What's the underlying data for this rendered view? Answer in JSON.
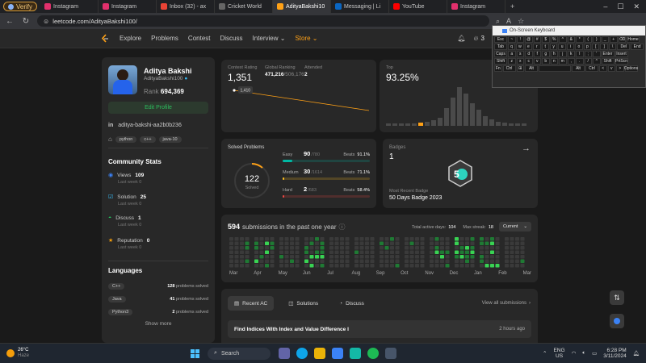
{
  "browser": {
    "verify_label": "Verify",
    "tabs": [
      {
        "label": "Instagram",
        "color": "#e1306c"
      },
      {
        "label": "Instagram",
        "color": "#e1306c"
      },
      {
        "label": "Inbox (32) - ax",
        "color": "#ea4335"
      },
      {
        "label": "Cricket World",
        "color": "#666666"
      },
      {
        "label": "AdityaBakshi10",
        "color": "#ffa116"
      },
      {
        "label": "Messaging | Li",
        "color": "#0a66c2"
      },
      {
        "label": "YouTube",
        "color": "#ff0000"
      },
      {
        "label": "Instagram",
        "color": "#e1306c"
      }
    ],
    "url": "leetcode.com/AdityaBakshi100/"
  },
  "nav": {
    "links": [
      "Explore",
      "Problems",
      "Contest",
      "Discuss",
      "Interview ⌄",
      "Store ⌄"
    ],
    "streak": "3"
  },
  "profile": {
    "name": "Aditya Bakshi",
    "username": "AdityaBakshi100",
    "rank_label": "Rank",
    "rank_value": "694,369",
    "edit_button": "Edit Profile",
    "linkedin": "aditya-bakshi-aa2b0b236",
    "tags": [
      "python",
      "c++",
      "java-10"
    ],
    "community_title": "Community Stats",
    "community": [
      {
        "label": "Views",
        "value": "109",
        "sub": "Last week 0",
        "color": "#3b82f6"
      },
      {
        "label": "Solution",
        "value": "25",
        "sub": "Last week 0",
        "color": "#38bdf8"
      },
      {
        "label": "Discuss",
        "value": "1",
        "sub": "Last week 0",
        "color": "#22c55e"
      },
      {
        "label": "Reputation",
        "value": "0",
        "sub": "Last week 0",
        "color": "#f59e0b"
      }
    ],
    "languages_title": "Languages",
    "languages": [
      {
        "name": "C++",
        "count": "128",
        "suffix": "problems solved"
      },
      {
        "name": "Java",
        "count": "41",
        "suffix": "problems solved"
      },
      {
        "name": "Python3",
        "count": "2",
        "suffix": "problems solved"
      }
    ],
    "show_more": "Show more"
  },
  "contest": {
    "rating_label": "Contest Rating",
    "rating_value": "1,351",
    "global_label": "Global Ranking",
    "global_value": "471,216",
    "global_total": "/506,176",
    "attended_label": "Attended",
    "attended_value": "2",
    "point_label": "1,410",
    "top_label": "Top",
    "top_value": "93.25%"
  },
  "solved": {
    "title": "Solved Problems",
    "total": "122",
    "total_label": "Solved",
    "rows": [
      {
        "level": "Easy",
        "count": "90",
        "total": "/780",
        "beats": "Beats",
        "pct": "91.1%",
        "color": "#00b8a3",
        "fill": 0.115
      },
      {
        "level": "Medium",
        "count": "30",
        "total": "/1614",
        "beats": "Beats",
        "pct": "71.1%",
        "color": "#ffc01e",
        "fill": 0.019
      },
      {
        "level": "Hard",
        "count": "2",
        "total": "/683",
        "beats": "Beats",
        "pct": "58.4%",
        "color": "#ef4743",
        "fill": 0.003
      }
    ]
  },
  "badges": {
    "title": "Badges",
    "count": "1",
    "recent_label": "Most Recent Badge",
    "recent_name": "50 Days Badge 2023"
  },
  "submissions": {
    "count": "594",
    "label": "submissions in the past one year",
    "active_label": "Total active days:",
    "active_value": "104",
    "streak_label": "Max streak:",
    "streak_value": "18",
    "dropdown": "Current",
    "months": [
      "Mar",
      "Apr",
      "May",
      "Jun",
      "Jul",
      "Aug",
      "Sep",
      "Oct",
      "Nov",
      "Dec",
      "Jan",
      "Feb",
      "Mar"
    ]
  },
  "recent": {
    "tabs": [
      "Recent AC",
      "Solutions",
      "Discuss"
    ],
    "view_all": "View all submissions",
    "item_title": "Find Indices With Index and Value Difference I",
    "item_time": "2 hours ago"
  },
  "osk": {
    "title": "On-Screen Keyboard",
    "rows": [
      [
        "Esc",
        "~",
        "!",
        "@",
        "#",
        "$",
        "%",
        "^",
        "&",
        "*",
        "(",
        ")",
        "_",
        "+",
        "⌫",
        "Home"
      ],
      [
        "Tab",
        "q",
        "w",
        "e",
        "r",
        "t",
        "y",
        "u",
        "i",
        "o",
        "p",
        "[",
        "]",
        "\\",
        "Del",
        "End"
      ],
      [
        "Caps",
        "a",
        "s",
        "d",
        "f",
        "g",
        "h",
        "j",
        "k",
        "l",
        ";",
        "'",
        "Enter",
        "Insert"
      ],
      [
        "Shift",
        "z",
        "x",
        "c",
        "v",
        "b",
        "n",
        "m",
        ",",
        ".",
        "/",
        "^",
        "Shift",
        "PrtScn"
      ],
      [
        "Fn",
        "Ctrl",
        "⊞",
        "Alt",
        "",
        "Alt",
        "Ctrl",
        "<",
        "v",
        ">",
        "Options"
      ]
    ]
  },
  "taskbar": {
    "weather_temp": "26°C",
    "weather_desc": "Haze",
    "search": "Search",
    "lang": "ENG",
    "region": "US",
    "time": "6:28 PM",
    "date": "3/11/2024"
  }
}
